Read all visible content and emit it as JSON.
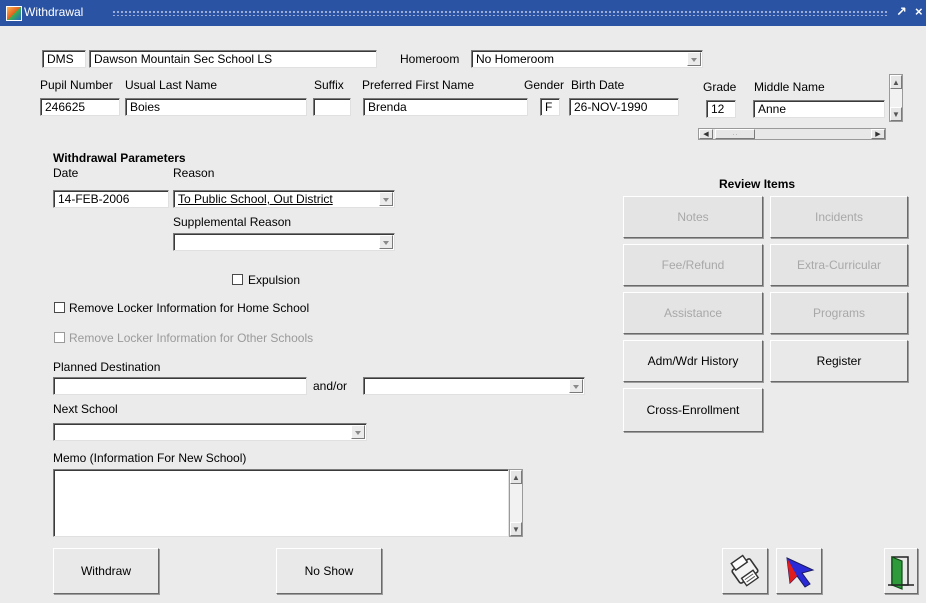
{
  "window": {
    "title": "Withdrawal"
  },
  "school": {
    "code": "DMS",
    "name": "Dawson Mountain Sec School LS"
  },
  "homeroom": {
    "label": "Homeroom",
    "value": "No Homeroom"
  },
  "pupil": {
    "labels": {
      "pupil_number": "Pupil Number",
      "usual_last_name": "Usual Last Name",
      "suffix": "Suffix",
      "preferred_first_name": "Preferred First Name",
      "gender": "Gender",
      "birth_date": "Birth Date",
      "grade": "Grade",
      "middle_name": "Middle Name"
    },
    "pupil_number": "246625",
    "usual_last_name": "Boies",
    "suffix": "",
    "preferred_first_name": "Brenda",
    "gender": "F",
    "birth_date": "26-NOV-1990",
    "grade": "12",
    "middle_name": "Anne"
  },
  "params": {
    "section_title": "Withdrawal Parameters",
    "date_label": "Date",
    "date": "14-FEB-2006",
    "reason_label": "Reason",
    "reason": "To Public School, Out District",
    "supp_reason_label": "Supplemental Reason",
    "supp_reason": "",
    "expulsion_label": "Expulsion",
    "remove_locker_home": "Remove Locker Information for Home School",
    "remove_locker_other": "Remove Locker Information for Other Schools",
    "planned_destination_label": "Planned Destination",
    "planned_destination": "",
    "andor_label": "and/or",
    "planned_destination_2": "",
    "next_school_label": "Next School",
    "next_school": "",
    "memo_label": "Memo (Information For New School)",
    "memo": ""
  },
  "review": {
    "title": "Review Items",
    "notes": "Notes",
    "incidents": "Incidents",
    "fee_refund": "Fee/Refund",
    "extra_curricular": "Extra-Curricular",
    "assistance": "Assistance",
    "programs": "Programs",
    "adm_wdr_history": "Adm/Wdr History",
    "register": "Register",
    "cross_enrollment": "Cross-Enrollment"
  },
  "actions": {
    "withdraw": "Withdraw",
    "no_show": "No Show"
  }
}
